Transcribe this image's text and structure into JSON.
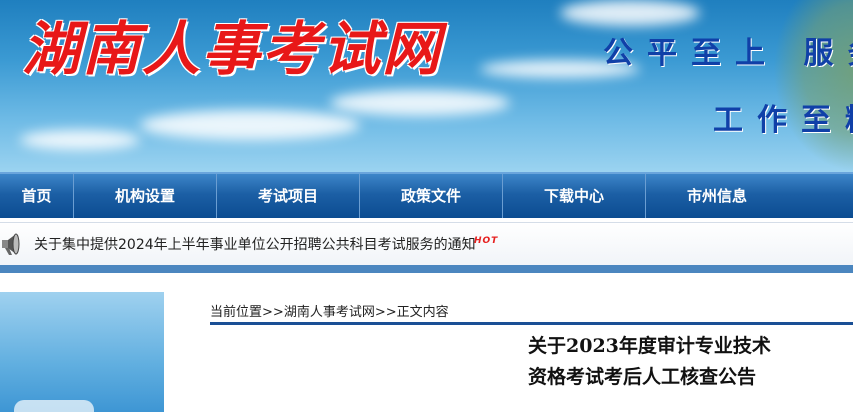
{
  "banner": {
    "site_name": "湖南人事考试网",
    "slogan_line1": "公平至上 服务",
    "slogan_line2": "工作至精"
  },
  "nav": {
    "items": [
      "首页",
      "机构设置",
      "考试项目",
      "政策文件",
      "下载中心",
      "市州信息"
    ]
  },
  "notice": {
    "text": "关于集中提供2024年上半年事业单位公开招聘公共科目考试服务的通知",
    "badge": "HOT"
  },
  "breadcrumb": {
    "label": "当前位置",
    "sep1": ">>",
    "home": "湖南人事考试网",
    "sep2": ">>",
    "current": "正文内容"
  },
  "article": {
    "title_line1": "关于2023年度审计专业技术",
    "title_line2": "资格考试考后人工核查公告"
  },
  "colors": {
    "nav_blue": "#1c5fa5",
    "logo_red": "#e81818",
    "slogan_blue": "#1040a8"
  }
}
